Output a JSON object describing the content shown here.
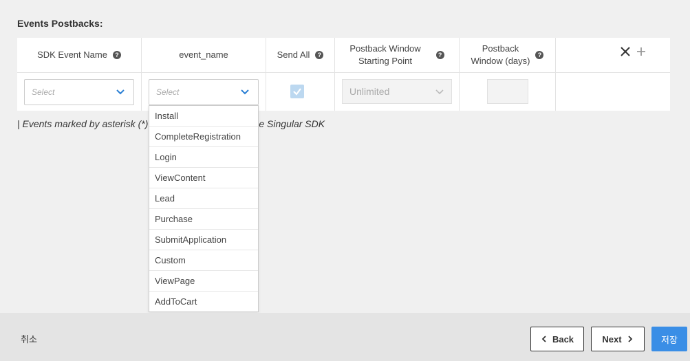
{
  "section": {
    "title": "Events Postbacks:"
  },
  "table": {
    "headers": {
      "sdk_event_name": "SDK Event Name",
      "event_name": "event_name",
      "send_all": "Send All",
      "postback_window_start_line1": "Postback Window",
      "postback_window_start_line2": "Starting Point",
      "postback_window_days_line1": "Postback",
      "postback_window_days_line2": "Window (days)"
    },
    "help_glyph": "?",
    "row": {
      "sdk_event_placeholder": "Select",
      "event_name_placeholder": "Select",
      "send_all_checked": true,
      "postback_window_start_value": "Unlimited",
      "postback_window_days_value": ""
    }
  },
  "note": {
    "text": "| Events marked by asterisk (*)",
    "text_tail": "e Singular SDK"
  },
  "dropdown": {
    "options": [
      "Install",
      "CompleteRegistration",
      "Login",
      "ViewContent",
      "Lead",
      "Purchase",
      "SubmitApplication",
      "Custom",
      "ViewPage",
      "AddToCart"
    ]
  },
  "footer": {
    "cancel_label": "취소",
    "back_label": "Back",
    "next_label": "Next",
    "save_label": "저장"
  },
  "colors": {
    "accent": "#3a8ee6",
    "checkbox": "#bcd8f0",
    "footer_bg": "#e4e4e4"
  }
}
